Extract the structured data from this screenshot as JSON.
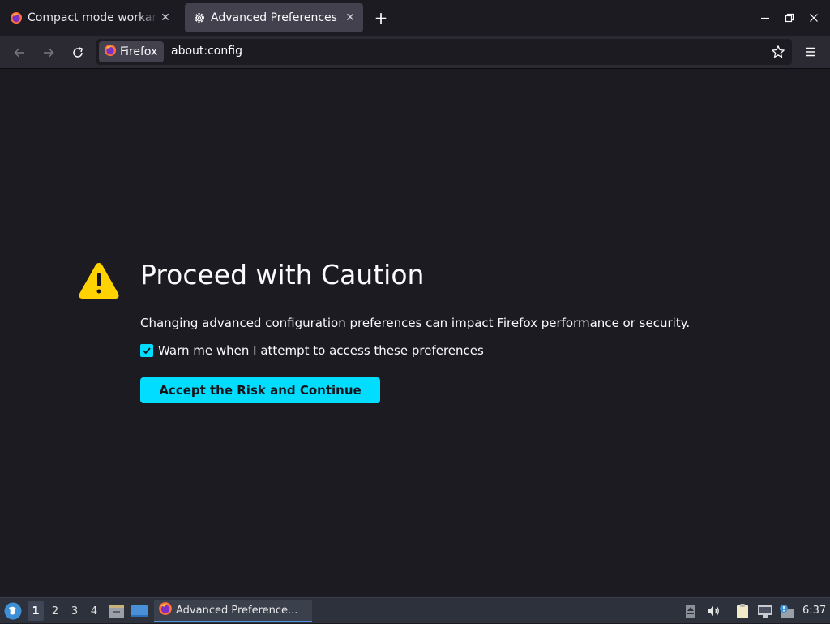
{
  "window": {
    "tabs": [
      {
        "label": "Compact mode workaround",
        "icon": "firefox-icon",
        "active": false
      },
      {
        "label": "Advanced Preferences",
        "icon": "gear-icon",
        "active": true
      }
    ],
    "new_tab_label": "+",
    "controls": [
      "minimize-icon",
      "restore-icon",
      "close-icon"
    ]
  },
  "navbar": {
    "identity_label": "Firefox",
    "url": "about:config"
  },
  "page": {
    "title": "Proceed with Caution",
    "description": "Changing advanced configuration preferences can impact Firefox performance or security.",
    "checkbox_label": "Warn me when I attempt to access these preferences",
    "checkbox_checked": true,
    "button_label": "Accept the Risk and Continue",
    "accent_color": "#00ddff",
    "warning_color": "#ffd200"
  },
  "taskbar": {
    "workspaces": [
      "1",
      "2",
      "3",
      "4"
    ],
    "active_workspace": "1",
    "task_label": "Advanced Preference...",
    "clock": "6:37"
  }
}
